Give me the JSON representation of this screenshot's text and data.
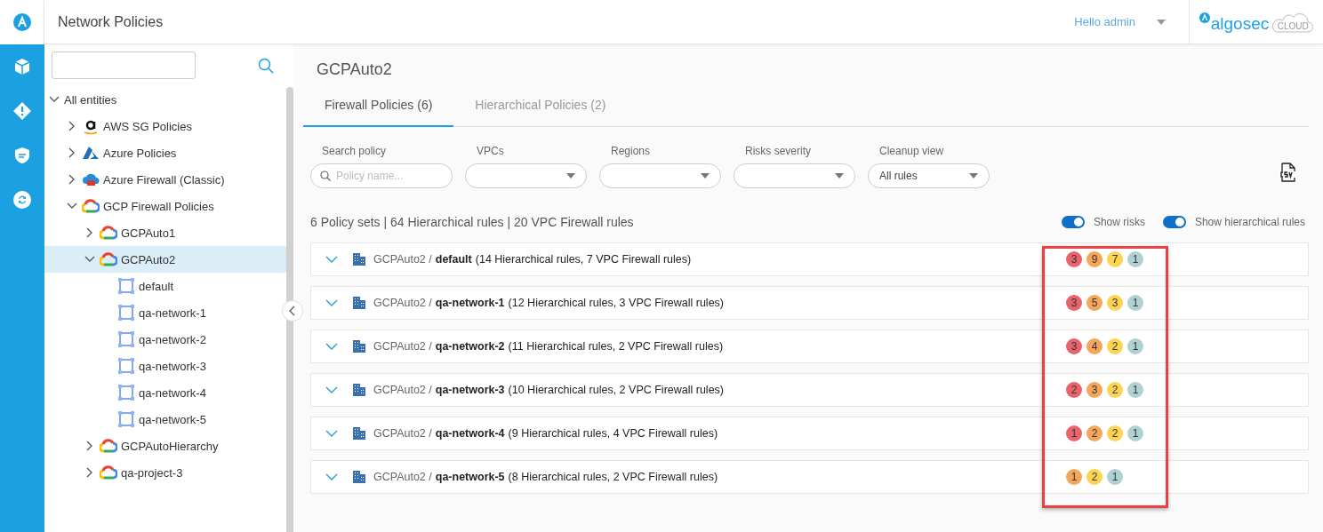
{
  "header": {
    "title": "Network Policies",
    "user": "Hello admin",
    "logo": {
      "name": "algosec",
      "suffix": "CLOUD"
    }
  },
  "rail": [
    {
      "kind": "box"
    },
    {
      "kind": "alert"
    },
    {
      "kind": "shield"
    },
    {
      "kind": "sync"
    }
  ],
  "tree": {
    "label": "All entities",
    "expanded": true,
    "children": [
      {
        "label": "AWS SG Policies",
        "kind": "amazon",
        "expanded": false,
        "selected": false
      },
      {
        "label": "Azure Policies",
        "kind": "azure",
        "expanded": false,
        "selected": false
      },
      {
        "label": "Azure Firewall (Classic)",
        "kind": "azure-firewall",
        "expanded": false,
        "selected": false
      },
      {
        "label": "GCP Firewall Policies",
        "kind": "gcp",
        "expanded": true,
        "selected": false,
        "children": [
          {
            "label": "GCPAuto1",
            "kind": "gcp",
            "expanded": false,
            "selected": false
          },
          {
            "label": "GCPAuto2",
            "kind": "gcp",
            "expanded": true,
            "selected": true,
            "children": [
              {
                "label": "default",
                "kind": "vpc",
                "selected": false
              },
              {
                "label": "qa-network-1",
                "kind": "vpc",
                "selected": false
              },
              {
                "label": "qa-network-2",
                "kind": "vpc",
                "selected": false
              },
              {
                "label": "qa-network-3",
                "kind": "vpc",
                "selected": false
              },
              {
                "label": "qa-network-4",
                "kind": "vpc",
                "selected": false
              },
              {
                "label": "qa-network-5",
                "kind": "vpc",
                "selected": false
              }
            ]
          },
          {
            "label": "GCPAutoHierarchy",
            "kind": "gcp",
            "expanded": false,
            "selected": false
          },
          {
            "label": "qa-project-3",
            "kind": "gcp",
            "expanded": false,
            "selected": false
          }
        ]
      }
    ]
  },
  "main": {
    "title": "GCPAuto2",
    "tabs": [
      {
        "label": "Firewall Policies (6)",
        "selected": true
      },
      {
        "label": "Hierarchical Policies (2)",
        "selected": false
      }
    ],
    "filters": [
      {
        "kind": "search",
        "label": "Search policy",
        "placeholder": "Policy name..."
      },
      {
        "kind": "select",
        "label": "VPCs"
      },
      {
        "kind": "select",
        "label": "Regions"
      },
      {
        "kind": "select",
        "label": "Risks severity"
      },
      {
        "kind": "select",
        "label": "Cleanup view",
        "value": "All rules"
      }
    ],
    "summary": "6 Policy sets | 64 Hierarchical rules | 20 VPC Firewall rules",
    "toggles": [
      {
        "label": "Show risks",
        "on": true
      },
      {
        "label": "Show hierarchical rules",
        "on": true
      }
    ],
    "rows": [
      {
        "project": "GCPAuto2 /",
        "network": "default",
        "details": "(14 Hierarchical rules, 7 VPC Firewall rules)",
        "expanded": false,
        "risks": [
          {
            "count": "3",
            "color": "#e8636b"
          },
          {
            "count": "9",
            "color": "#f4a65a"
          },
          {
            "count": "7",
            "color": "#fdd451"
          },
          {
            "count": "1",
            "color": "#afd1d3"
          }
        ]
      },
      {
        "project": "GCPAuto2 /",
        "network": "qa-network-1",
        "details": "(12 Hierarchical rules, 3 VPC Firewall rules)",
        "expanded": false,
        "risks": [
          {
            "count": "3",
            "color": "#e8636b"
          },
          {
            "count": "5",
            "color": "#f4a65a"
          },
          {
            "count": "3",
            "color": "#fdd451"
          },
          {
            "count": "1",
            "color": "#afd1d3"
          }
        ]
      },
      {
        "project": "GCPAuto2 /",
        "network": "qa-network-2",
        "details": "(11 Hierarchical rules, 2 VPC Firewall rules)",
        "expanded": false,
        "risks": [
          {
            "count": "3",
            "color": "#e8636b"
          },
          {
            "count": "4",
            "color": "#f4a65a"
          },
          {
            "count": "2",
            "color": "#fdd451"
          },
          {
            "count": "1",
            "color": "#afd1d3"
          }
        ]
      },
      {
        "project": "GCPAuto2 /",
        "network": "qa-network-3",
        "details": "(10 Hierarchical rules, 2 VPC Firewall rules)",
        "expanded": false,
        "risks": [
          {
            "count": "2",
            "color": "#e8636b"
          },
          {
            "count": "3",
            "color": "#f4a65a"
          },
          {
            "count": "2",
            "color": "#fdd451"
          },
          {
            "count": "1",
            "color": "#afd1d3"
          }
        ]
      },
      {
        "project": "GCPAuto2 /",
        "network": "qa-network-4",
        "details": "(9 Hierarchical rules, 4 VPC Firewall rules)",
        "expanded": false,
        "risks": [
          {
            "count": "1",
            "color": "#e8636b"
          },
          {
            "count": "2",
            "color": "#f4a65a"
          },
          {
            "count": "2",
            "color": "#fdd451"
          },
          {
            "count": "1",
            "color": "#afd1d3"
          }
        ]
      },
      {
        "project": "GCPAuto2 /",
        "network": "qa-network-5",
        "details": "(8 Hierarchical rules, 2 VPC Firewall rules)",
        "expanded": false,
        "risks": [
          {
            "count": "1",
            "color": "#f4a65a"
          },
          {
            "count": "2",
            "color": "#fdd451"
          },
          {
            "count": "1",
            "color": "#afd1d3"
          }
        ]
      }
    ]
  }
}
